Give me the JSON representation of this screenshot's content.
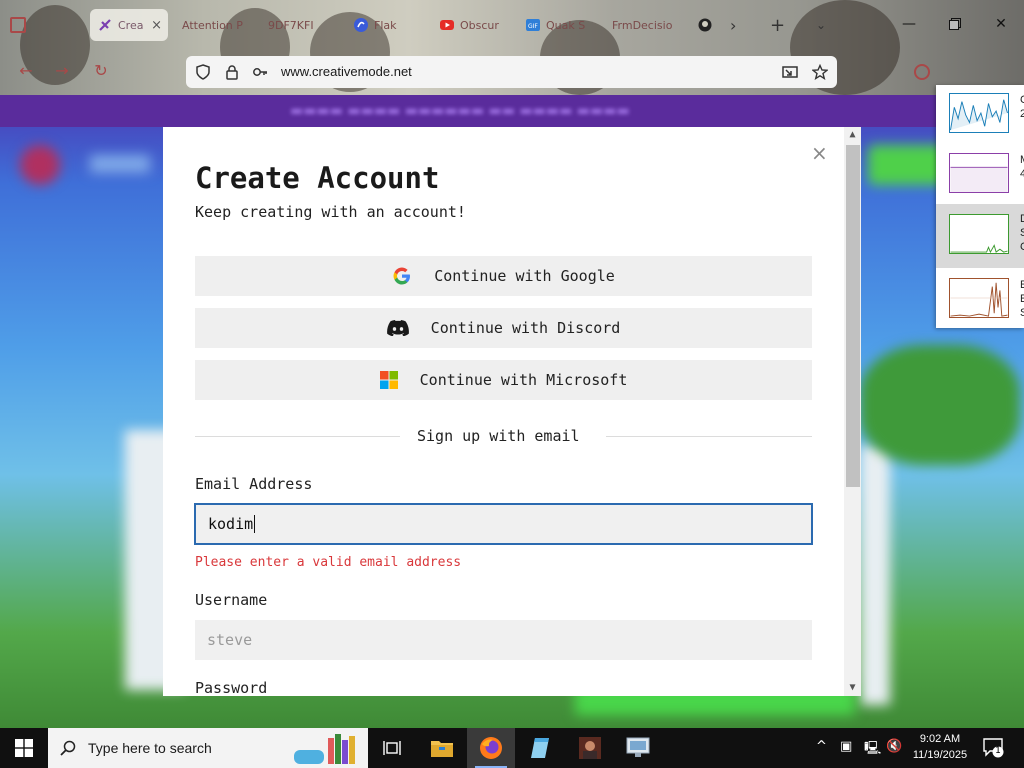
{
  "browser": {
    "tabs": [
      {
        "label": "Crea",
        "active": true
      },
      {
        "label": "Attention P"
      },
      {
        "label": "9DF7KFI"
      },
      {
        "label": "Flak"
      },
      {
        "label": "Obscur"
      },
      {
        "label": "Quak S"
      },
      {
        "label": "FrmDecisio"
      }
    ],
    "tab_close": "×",
    "new_tab": "+",
    "url": "www.creativemode.net",
    "window_controls": [
      "minimize",
      "maximize",
      "close"
    ]
  },
  "modal": {
    "close": "×",
    "title": "Create Account",
    "subtitle": "Keep creating with an account!",
    "oauth": [
      {
        "label": "Continue with Google",
        "icon": "google-icon"
      },
      {
        "label": "Continue with Discord",
        "icon": "discord-icon"
      },
      {
        "label": "Continue with Microsoft",
        "icon": "microsoft-icon"
      }
    ],
    "divider": "Sign up with email",
    "email_label": "Email Address",
    "email_value": "kodim",
    "email_error": "Please enter a valid email address",
    "username_label": "Username",
    "username_placeholder": "steve",
    "password_label": "Password"
  },
  "perf_panel": {
    "rows": [
      {
        "label_lines": [
          "C",
          "2"
        ],
        "color": "#1b7fb8"
      },
      {
        "label_lines": [
          "M",
          "4"
        ],
        "color": "#8b3fa8"
      },
      {
        "label_lines": [
          "D",
          "S",
          "C"
        ],
        "color": "#3c9a2f",
        "selected": true
      },
      {
        "label_lines": [
          "E",
          "E",
          "S"
        ],
        "color": "#a0522d"
      }
    ]
  },
  "taskbar": {
    "search_placeholder": "Type here to search",
    "time": "9:02 AM",
    "date": "11/19/2025",
    "notification_count": "1"
  },
  "colors": {
    "accent": "#2b6ab0",
    "error": "#d9383b",
    "site_purple": "#5a2c9c"
  }
}
